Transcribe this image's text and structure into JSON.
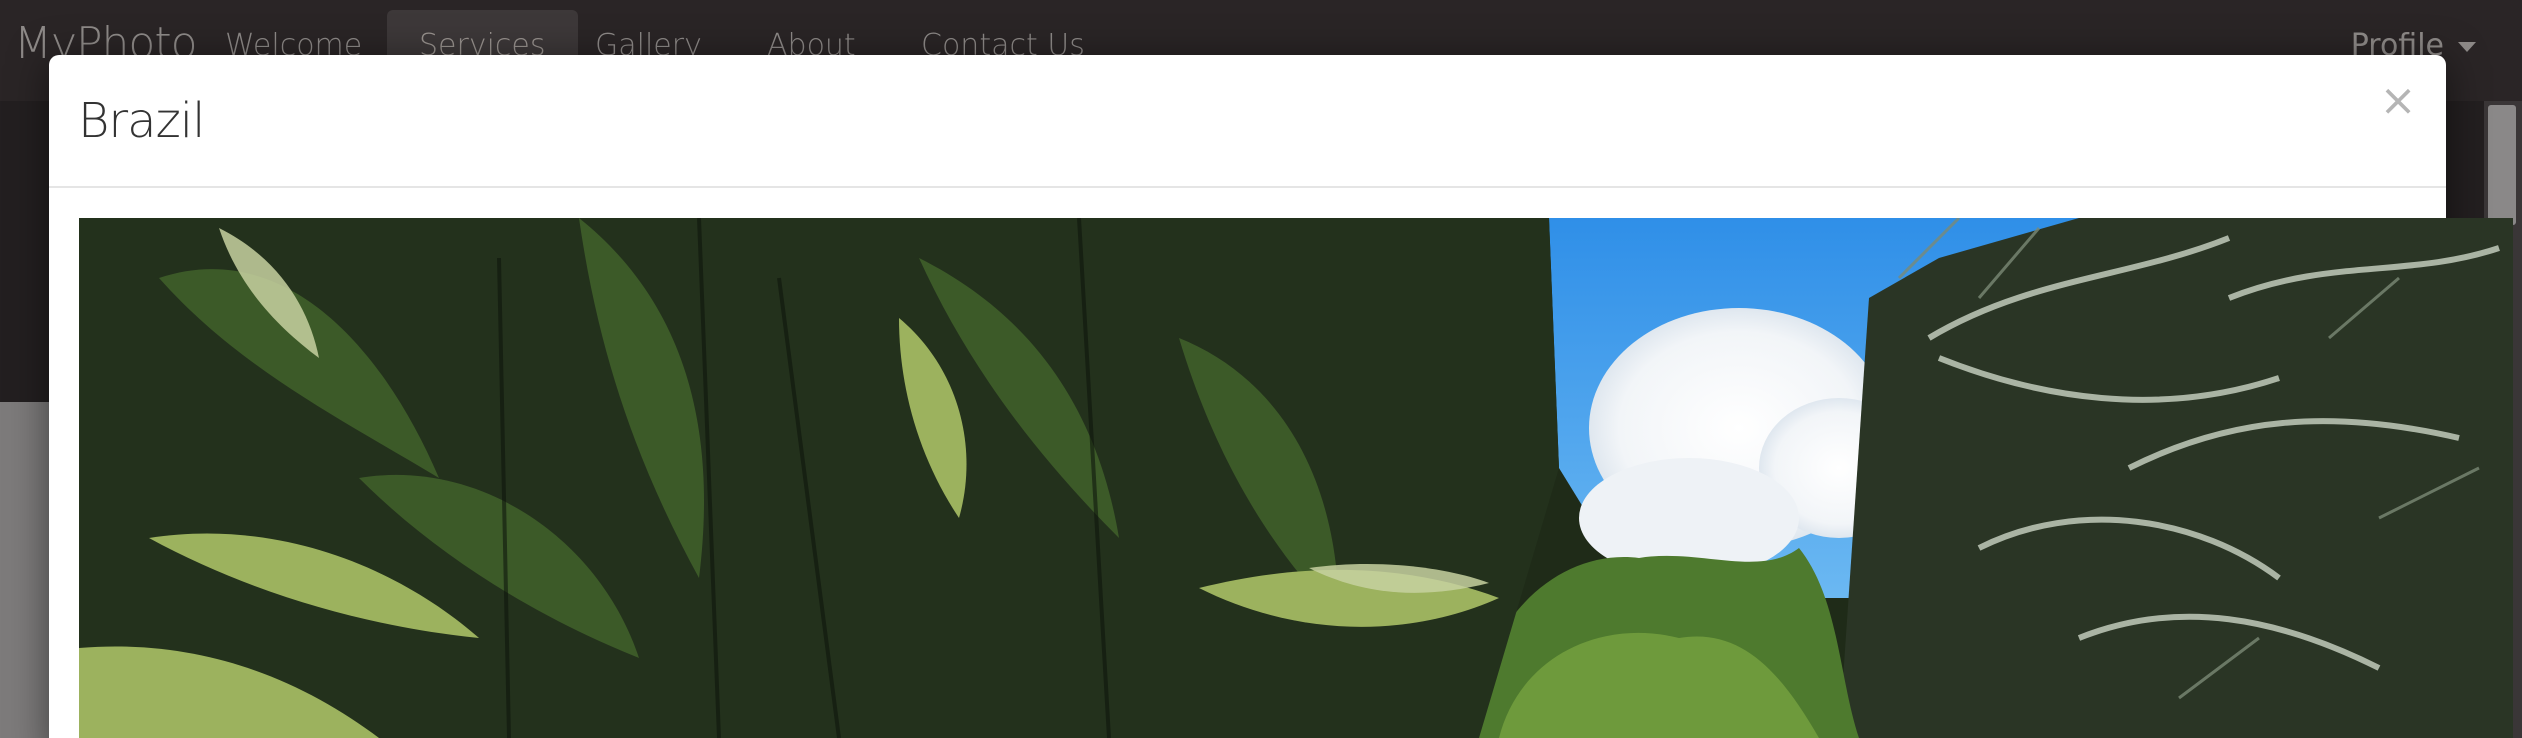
{
  "navbar": {
    "brand": "MyPhoto",
    "items": [
      {
        "label": "Welcome"
      },
      {
        "label": "Services"
      },
      {
        "label": "Gallery"
      },
      {
        "label": "About"
      },
      {
        "label": "Contact Us"
      }
    ],
    "active_item": "Services",
    "profile_label": "Profile"
  },
  "modal": {
    "title": "Brazil",
    "close_label": "×",
    "image_description": "Tropical palm trees against blue sky with white cloud"
  },
  "colors": {
    "navbar_bg": "#2a2526",
    "nav_text": "#8e8a88",
    "active_bg": "#3d3839",
    "overlay_gray": "#7d7b7b",
    "modal_bg": "#ffffff",
    "sky": "#3c9ae6",
    "foliage_dark": "#22301a",
    "foliage_light": "#9fb56a"
  }
}
